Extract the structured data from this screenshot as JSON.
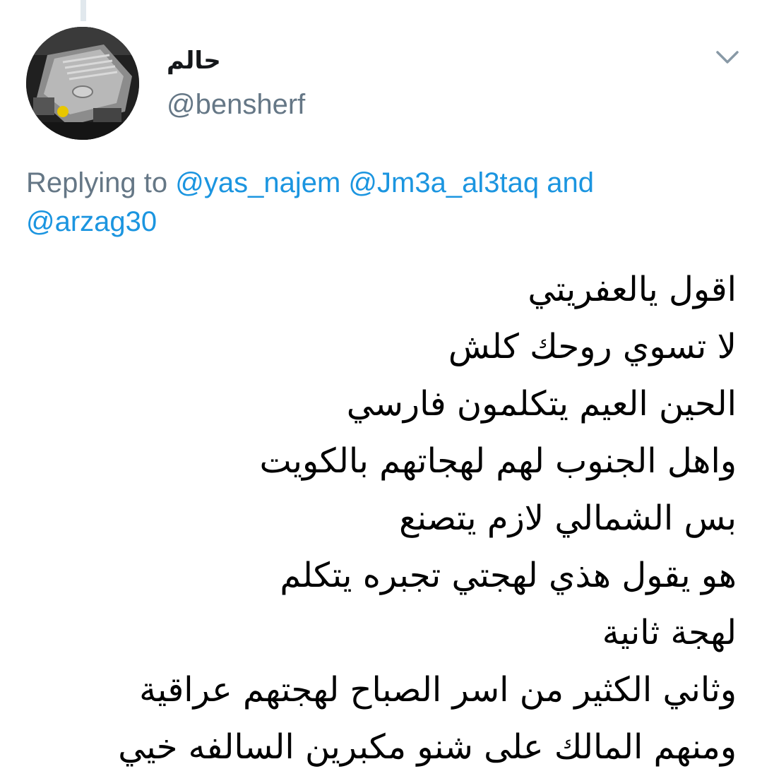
{
  "tweet": {
    "author": {
      "display_name": "حالم",
      "handle": "@bensherf",
      "avatar_icon": "car-engine-avatar"
    },
    "menu_icon": "chevron-down-icon",
    "reply": {
      "prefix": "Replying to",
      "mention_1": "@yas_najem",
      "mention_2": "@Jm3a_al3taq",
      "conjunction": "and",
      "mention_3": "@arzag30"
    },
    "body_lines": [
      "اقول يالعفريتي",
      "لا تسوي روحك كلش",
      "الحين العيم يتكلمون فارسي",
      "واهل الجنوب لهم لهجاتهم بالكويت",
      "بس الشمالي لازم يتصنع",
      "هو يقول هذي لهجتي تجبره يتكلم",
      "لهجة ثانية",
      "وثاني الكثير من اسر الصباح لهجتهم عراقية",
      "ومنهم المالك على شنو مكبرين السالفه خيي"
    ]
  },
  "colors": {
    "text": "#14171a",
    "secondary": "#657786",
    "link": "#1b95e0",
    "thread_line": "#e1e8ed"
  }
}
